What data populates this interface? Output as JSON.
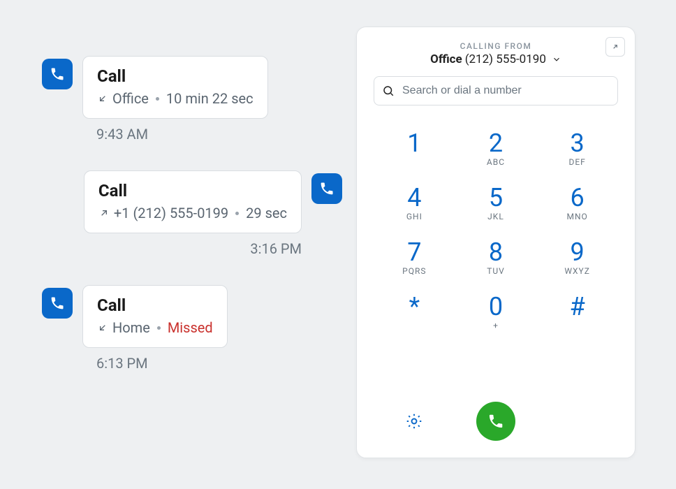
{
  "log": [
    {
      "direction": "in",
      "title": "Call",
      "arrow": "incoming",
      "line1": "Office",
      "line2": "10 min 22 sec",
      "missed": false,
      "time": "9:43 AM"
    },
    {
      "direction": "out",
      "title": "Call",
      "arrow": "outgoing",
      "line1": "+1 (212) 555-0199",
      "line2": "29 sec",
      "missed": false,
      "time": "3:16 PM"
    },
    {
      "direction": "in",
      "title": "Call",
      "arrow": "incoming",
      "line1": "Home",
      "line2": "Missed",
      "missed": true,
      "time": "6:13 PM"
    }
  ],
  "dialer": {
    "from_label": "CALLING FROM",
    "from_name": "Office",
    "from_number": "(212) 555-0190",
    "search_placeholder": "Search or dial a number",
    "keys": [
      {
        "d": "1",
        "l": ""
      },
      {
        "d": "2",
        "l": "ABC"
      },
      {
        "d": "3",
        "l": "DEF"
      },
      {
        "d": "4",
        "l": "GHI"
      },
      {
        "d": "5",
        "l": "JKL"
      },
      {
        "d": "6",
        "l": "MNO"
      },
      {
        "d": "7",
        "l": "PQRS"
      },
      {
        "d": "8",
        "l": "TUV"
      },
      {
        "d": "9",
        "l": "WXYZ"
      },
      {
        "d": "*",
        "l": ""
      },
      {
        "d": "0",
        "l": "+"
      },
      {
        "d": "#",
        "l": ""
      }
    ]
  }
}
